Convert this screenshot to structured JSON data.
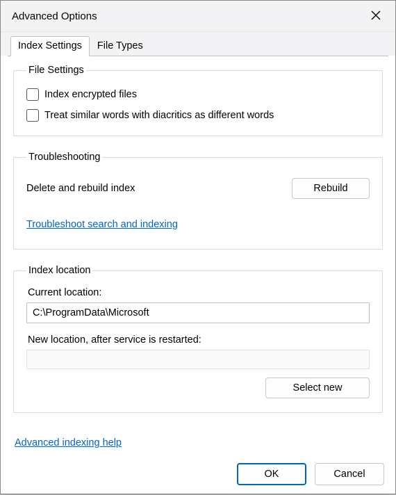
{
  "title": "Advanced Options",
  "tabs": {
    "index_settings": "Index Settings",
    "file_types": "File Types"
  },
  "file_settings": {
    "legend": "File Settings",
    "index_encrypted": "Index encrypted files",
    "diacritics": "Treat similar words with diacritics as different words"
  },
  "troubleshooting": {
    "legend": "Troubleshooting",
    "delete_rebuild": "Delete and rebuild index",
    "rebuild_btn": "Rebuild",
    "troubleshoot_link": "Troubleshoot search and indexing"
  },
  "location": {
    "legend": "Index location",
    "current_label": "Current location:",
    "current_value": "C:\\ProgramData\\Microsoft",
    "new_label": "New location, after service is restarted:",
    "select_new_btn": "Select new"
  },
  "advanced_help": "Advanced indexing help",
  "buttons": {
    "ok": "OK",
    "cancel": "Cancel"
  }
}
